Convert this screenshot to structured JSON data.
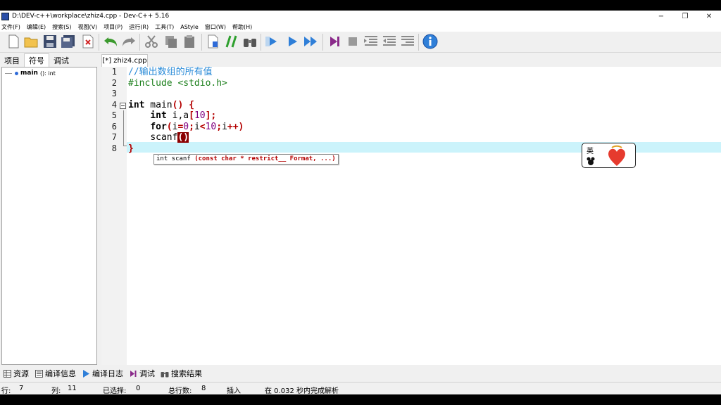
{
  "window": {
    "title": "D:\\DEV-c++\\workplace\\zhiz4.cpp - Dev-C++ 5.16",
    "controls": {
      "minimize": "−",
      "maximize": "❐",
      "close": "✕"
    }
  },
  "menu": [
    "文件(F)",
    "编辑(E)",
    "搜索(S)",
    "视图(V)",
    "项目(P)",
    "运行(R)",
    "工具(T)",
    "AStyle",
    "窗口(W)",
    "帮助(H)"
  ],
  "toolbar": {
    "icons": [
      "new-file-icon",
      "open-folder-icon",
      "save-icon",
      "save-all-icon",
      "close-file-icon",
      "undo-icon",
      "redo-icon",
      "cut-icon",
      "copy-icon",
      "paste-icon",
      "project-file-icon",
      "comment-icon",
      "find-binoculars-icon",
      "compile-icon",
      "run-icon",
      "compile-run-icon",
      "debug-icon",
      "stop-icon",
      "indent-icon",
      "unindent-icon",
      "toggle-icon",
      "info-icon"
    ]
  },
  "left_panel": {
    "tabs": [
      "项目",
      "符号",
      "调试"
    ],
    "active_tab": "符号",
    "tree": {
      "name": "main",
      "signature": "(): int"
    }
  },
  "editor": {
    "tab_label": "[*] zhiz4.cpp",
    "line_numbers": [
      "1",
      "2",
      "3",
      "4",
      "5",
      "6",
      "7",
      "8"
    ],
    "code": {
      "l1": "//输出数组的所有值",
      "l2": "#include <stdio.h>",
      "l4_kw": "int",
      "l4_rest": " main",
      "l4_paren": "()",
      "l4_brace": " {",
      "l5_kw": "int",
      "l5_var": " i,a",
      "l5_lb": "[",
      "l5_num": "10",
      "l5_rb": "];",
      "l6_kw": "for",
      "l6_p1": "(",
      "l6_a": "i",
      "l6_eq": "=",
      "l6_zero": "0",
      "l6_semi1": ";",
      "l6_b": "i",
      "l6_lt": "<",
      "l6_ten": "10",
      "l6_semi2": ";",
      "l6_c": "i",
      "l6_pp": "++)",
      "l7_fn": "scanf",
      "l7_paren": "()",
      "l8": "}"
    },
    "tooltip": {
      "signature": "int scanf",
      "params": "(const char * restrict__ Format, ...)"
    },
    "ime": {
      "label": "英"
    }
  },
  "bottom_tabs": [
    "资源",
    "编译信息",
    "编译日志",
    "调试",
    "搜索结果"
  ],
  "status": {
    "row_label": "行:",
    "row_value": "7",
    "col_label": "列:",
    "col_value": "11",
    "selected_label": "已选择:",
    "selected_value": "0",
    "total_label": "总行数:",
    "total_value": "8",
    "mode": "插入",
    "message": "在 0.032 秒内完成解析"
  }
}
